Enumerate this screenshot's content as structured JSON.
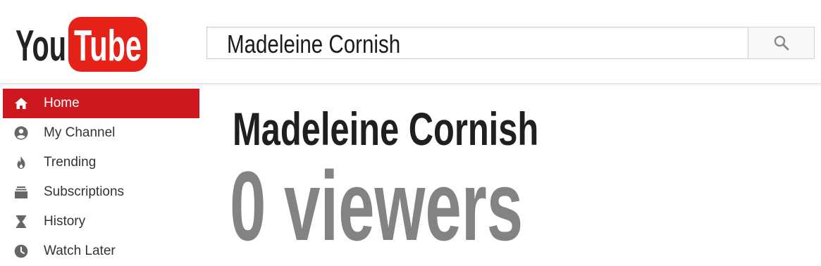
{
  "header": {
    "logo": {
      "text_you": "You",
      "text_tube": "Tube"
    },
    "search": {
      "value": "Madeleine Cornish",
      "icon": "search-icon"
    }
  },
  "sidebar": {
    "items": [
      {
        "label": "Home",
        "icon": "home-icon",
        "active": true
      },
      {
        "label": "My Channel",
        "icon": "account-icon",
        "active": false
      },
      {
        "label": "Trending",
        "icon": "flame-icon",
        "active": false
      },
      {
        "label": "Subscriptions",
        "icon": "subscriptions-icon",
        "active": false
      },
      {
        "label": "History",
        "icon": "hourglass-icon",
        "active": false
      },
      {
        "label": "Watch Later",
        "icon": "clock-icon",
        "active": false
      }
    ]
  },
  "main": {
    "channel_name": "Madeleine Cornish",
    "viewers_text": "0 viewers"
  },
  "colors": {
    "accent_red": "#cc181e",
    "sidebar_icon": "#666666",
    "viewers_text": "#838383"
  }
}
